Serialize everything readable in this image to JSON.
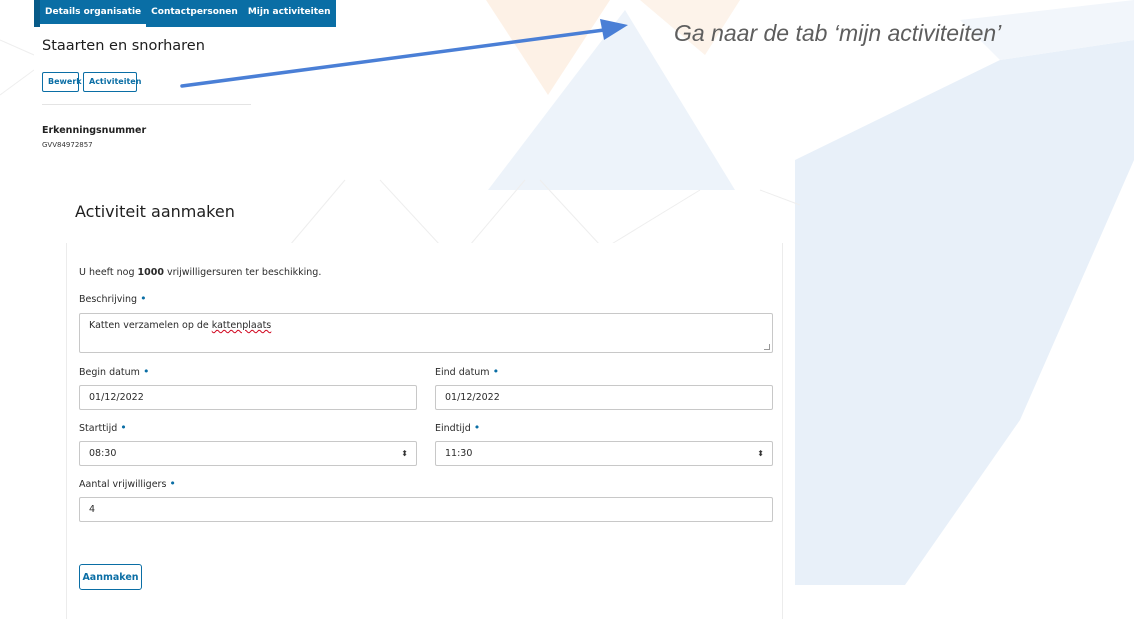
{
  "instruction": "Ga naar de tab ‘mijn activiteiten’",
  "org_page": {
    "tabs": [
      {
        "label": "Details organisatie",
        "active": true
      },
      {
        "label": "Contactpersonen",
        "active": false
      },
      {
        "label": "Mijn activiteiten",
        "active": false
      }
    ],
    "title": "Staarten en snorharen",
    "buttons": {
      "edit": "Bewerk",
      "activities": "Activiteiten"
    },
    "erkenning_label": "Erkenningsnummer",
    "erkenning_value": "GVV84972857"
  },
  "form": {
    "title": "Activiteit aanmaken",
    "hours_prefix": "U heeft nog ",
    "hours_value": "1000",
    "hours_suffix": " vrijwilligersuren ter beschikking.",
    "required_mark": "•",
    "beschrijving_label": "Beschrijving",
    "beschrijving_text": "Katten verzamelen op de ",
    "beschrijving_misspelled": "kattenplaats",
    "begin_label": "Begin datum",
    "begin_value": "01/12/2022",
    "eind_label": "Eind datum",
    "eind_value": "01/12/2022",
    "starttijd_label": "Starttijd",
    "starttijd_value": "08:30",
    "eindtijd_label": "Eindtijd",
    "eindtijd_value": "11:30",
    "aantal_label": "Aantal vrijwilligers",
    "aantal_value": "4",
    "submit_label": "Aanmaken",
    "select_arrow": "⬍"
  },
  "colors": {
    "primary": "#0a6ea5",
    "arrow": "#4a7fd6",
    "instruction_text": "#5e5e5e",
    "bg_orange": "#fbeadb",
    "bg_blue": "#e3edf8"
  }
}
